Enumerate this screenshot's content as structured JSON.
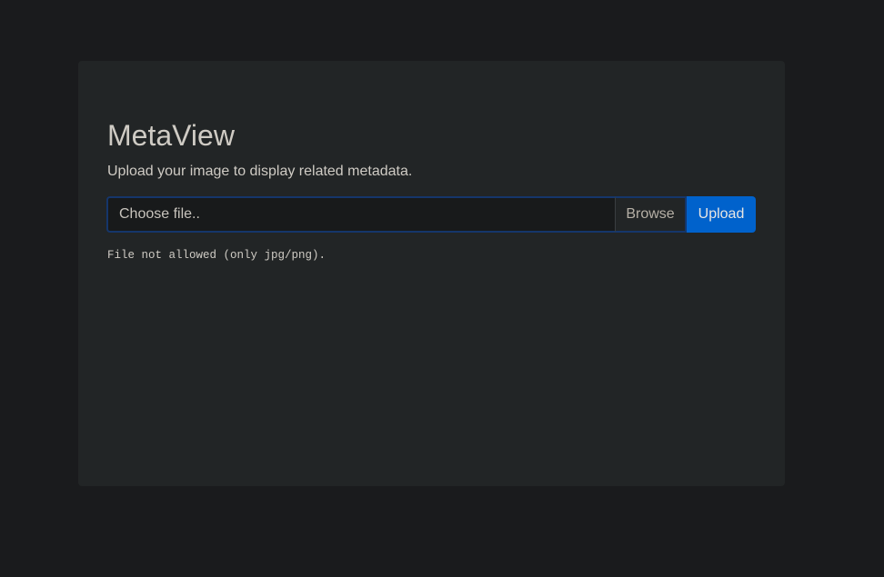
{
  "app": {
    "title": "MetaView",
    "subtitle": "Upload your image to display related metadata."
  },
  "upload": {
    "file_placeholder": "Choose file..",
    "browse_label": "Browse",
    "upload_label": "Upload"
  },
  "status": {
    "message": "File not allowed (only jpg/png)."
  },
  "colors": {
    "page_background": "#1a1b1d",
    "card_background": "#222526",
    "primary_button": "#0062cc",
    "focus_border": "#15366b"
  }
}
